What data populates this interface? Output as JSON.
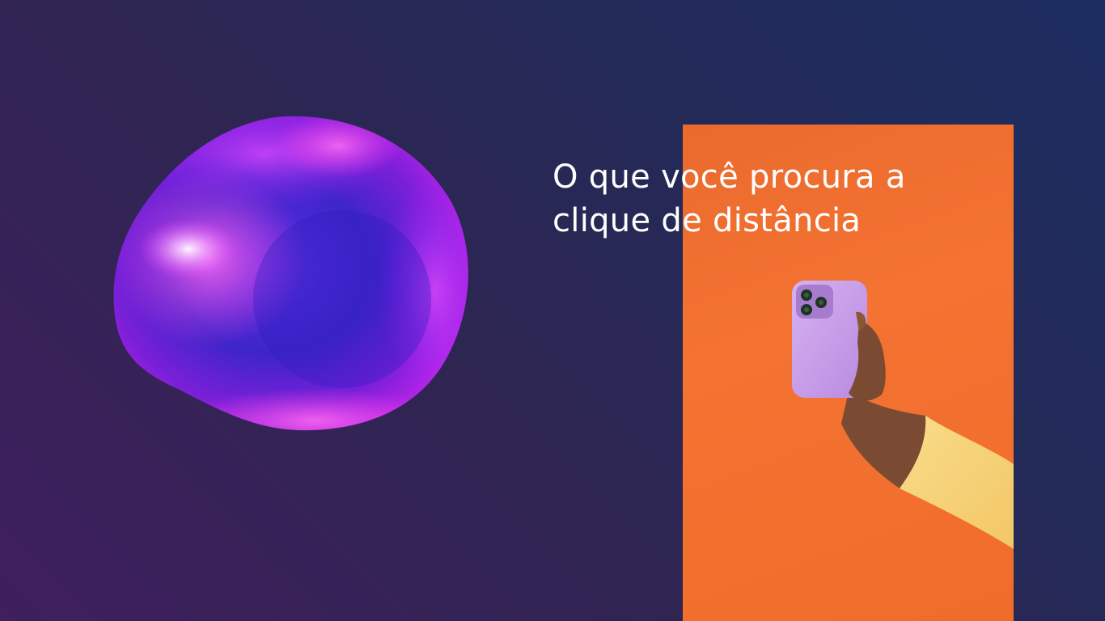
{
  "slide": {
    "headline_lines": [
      "O que você procura a",
      "clique de distância"
    ]
  },
  "colors": {
    "background_left": "#3f1f5e",
    "background_right": "#1d2d60",
    "panel_orange": "#f47332",
    "phone_case": "#c9a1e8",
    "sleeve": "#f6d27a",
    "skin": "#7a4a33",
    "text": "#ffffff"
  },
  "icons": {
    "bubble": "glossy-purple-bubble-icon",
    "phone": "phone-in-hand-icon"
  }
}
